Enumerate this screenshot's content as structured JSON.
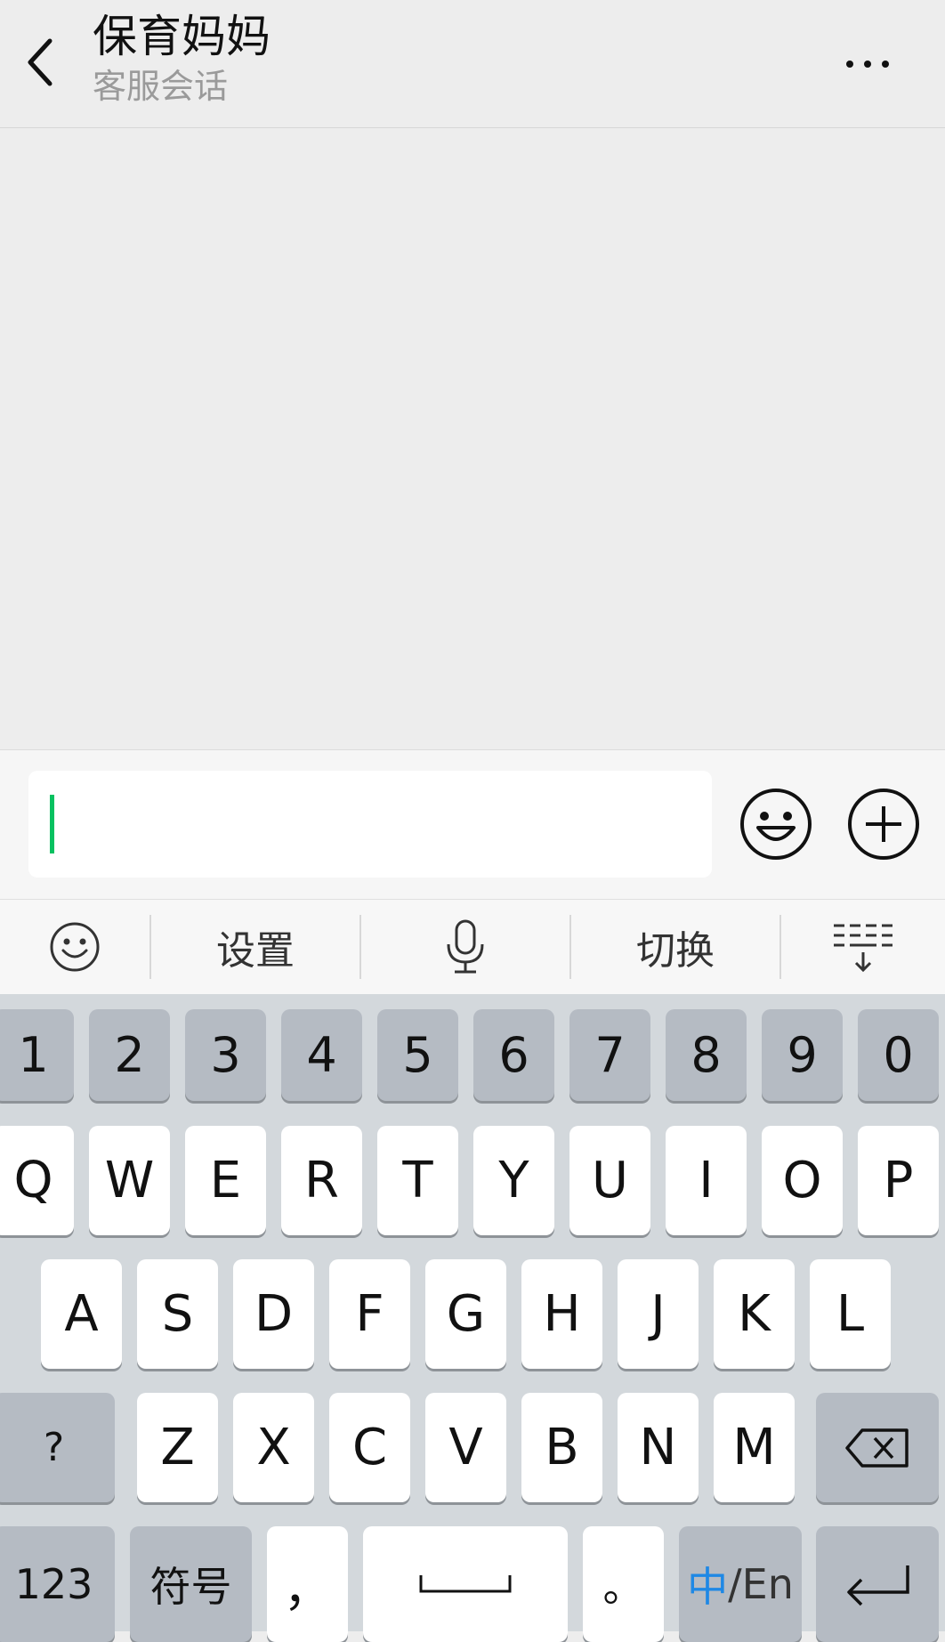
{
  "header": {
    "title": "保育妈妈",
    "subtitle": "客服会话",
    "back_icon": "chevron-left-icon",
    "more_icon": "more-horizontal-icon"
  },
  "input_bar": {
    "value": "",
    "emoji_icon": "smiley-icon",
    "plus_icon": "plus-circle-icon",
    "cursor_color": "#07C160"
  },
  "ime_toolbar": {
    "emoji_icon": "smiley-icon",
    "settings_label": "设置",
    "mic_icon": "microphone-icon",
    "switch_label": "切换",
    "hide_icon": "keyboard-hide-icon"
  },
  "keyboard": {
    "row_numbers": [
      "1",
      "2",
      "3",
      "4",
      "5",
      "6",
      "7",
      "8",
      "9",
      "0"
    ],
    "row_q": [
      "Q",
      "W",
      "E",
      "R",
      "T",
      "Y",
      "U",
      "I",
      "O",
      "P"
    ],
    "row_a": [
      "A",
      "S",
      "D",
      "F",
      "G",
      "H",
      "J",
      "K",
      "L"
    ],
    "row_z": [
      "Z",
      "X",
      "C",
      "V",
      "B",
      "N",
      "M"
    ],
    "question_label": "?",
    "delete_icon": "backspace-icon",
    "num_label": "123",
    "symbol_label": "符号",
    "comma_label": "，",
    "space_icon": "space-bar-icon",
    "period_label": "。",
    "lang_zh": "中",
    "lang_en": "/En",
    "enter_icon": "return-icon",
    "lang_accent_color": "#1E88E5"
  }
}
